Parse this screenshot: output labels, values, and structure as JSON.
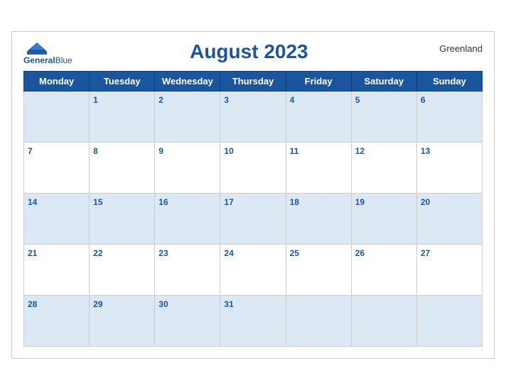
{
  "header": {
    "logo_line1": "General",
    "logo_line2": "Blue",
    "title": "August 2023",
    "region": "Greenland"
  },
  "days_of_week": [
    "Monday",
    "Tuesday",
    "Wednesday",
    "Thursday",
    "Friday",
    "Saturday",
    "Sunday"
  ],
  "weeks": [
    [
      "",
      "1",
      "2",
      "3",
      "4",
      "5",
      "6"
    ],
    [
      "7",
      "8",
      "9",
      "10",
      "11",
      "12",
      "13"
    ],
    [
      "14",
      "15",
      "16",
      "17",
      "18",
      "19",
      "20"
    ],
    [
      "21",
      "22",
      "23",
      "24",
      "25",
      "26",
      "27"
    ],
    [
      "28",
      "29",
      "30",
      "31",
      "",
      "",
      ""
    ]
  ]
}
